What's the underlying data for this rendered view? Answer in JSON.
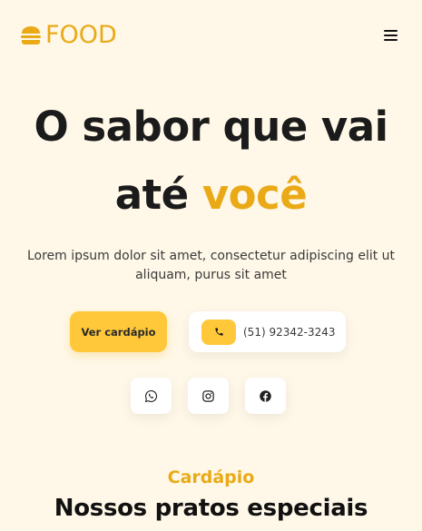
{
  "header": {
    "logo_text": "FOOD",
    "logo_icon": "burger-icon",
    "menu_icon": "hamburger-menu-icon"
  },
  "hero": {
    "title_line1": "O sabor que vai",
    "title_line2_plain": "até ",
    "title_line2_accent": "você",
    "description": "Lorem ipsum dolor sit amet, consectetur adipiscing elit ut aliquam, purus sit amet",
    "cta_label": "Ver cardápio",
    "phone_number": "(51) 92342-3243",
    "phone_icon": "phone-icon"
  },
  "social": [
    {
      "name": "whatsapp",
      "icon": "whatsapp-icon"
    },
    {
      "name": "instagram",
      "icon": "instagram-icon"
    },
    {
      "name": "facebook",
      "icon": "facebook-icon"
    }
  ],
  "menu_section": {
    "eyebrow": "Cardápio",
    "title": "Nossos pratos especiais"
  },
  "colors": {
    "background": "#fff8e8",
    "accent": "#eaaa17",
    "button": "#ffc83a",
    "text": "#1b1b1b"
  }
}
